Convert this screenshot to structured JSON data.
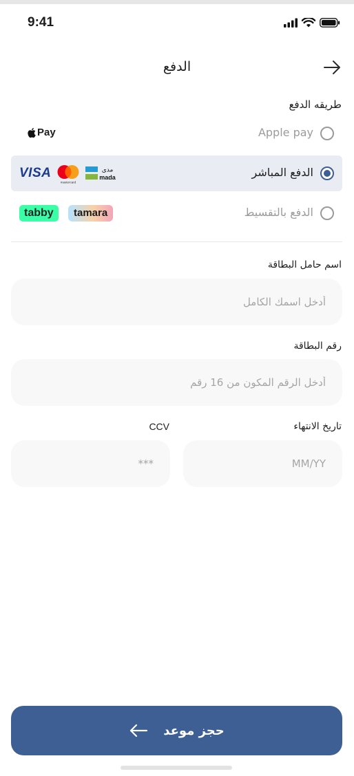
{
  "status_bar": {
    "time": "9:41"
  },
  "header": {
    "title": "الدفع"
  },
  "payment_method": {
    "label": "طريقه الدفع",
    "options": [
      {
        "label": "Apple pay",
        "brand": "Pay",
        "selected": false
      },
      {
        "label": "الدفع المباشر",
        "selected": true,
        "brands": {
          "visa": "VISA",
          "mastercard": "mastercard",
          "mada_ar": "مدى",
          "mada_en": "mada"
        }
      },
      {
        "label": "الدفع بالتقسيط",
        "selected": false,
        "brands": {
          "tabby": "tabby",
          "tamara": "tamara"
        }
      }
    ]
  },
  "card_form": {
    "holder_label": "اسم حامل البطاقة",
    "holder_placeholder": "أدخل اسمك الكامل",
    "number_label": "رقم البطاقة",
    "number_placeholder": "أدخل الرقم المكون من 16 رقم",
    "expiry_label": "تاريخ  الانتهاء",
    "expiry_placeholder": "MM/YY",
    "ccv_label": "CCV",
    "ccv_placeholder": "***"
  },
  "cta": {
    "label": "حجز موعد"
  },
  "colors": {
    "primary": "#3d5f93",
    "selected_row": "#e9edf3",
    "field_bg": "#f8f8f8"
  }
}
